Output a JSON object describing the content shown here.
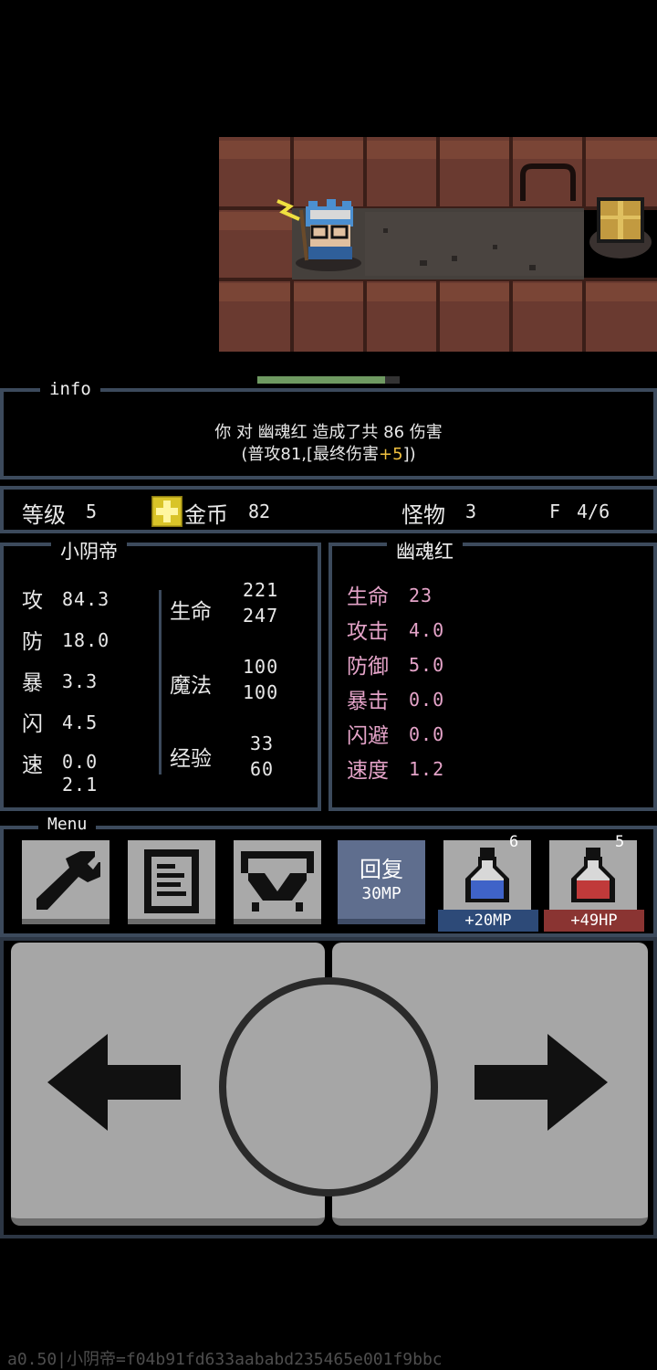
{
  "info": {
    "title": "info",
    "message_line1": "你 对 幽魂红 造成了共 86 伤害",
    "message_line2_prefix": "(普攻81,[最终伤害",
    "message_line2_bonus": "+5",
    "message_line2_suffix": "])"
  },
  "enemy_hp_fraction": 0.9,
  "status": {
    "level_label": "等级",
    "level_value": "5",
    "gold_label": "金币",
    "gold_value": "82",
    "monster_label": "怪物",
    "monster_value": "3",
    "floor_label": "F",
    "floor_value": "4/6"
  },
  "player": {
    "name": "小阴帝",
    "attack_label": "攻",
    "attack": "84.3",
    "defense_label": "防",
    "defense": "18.0",
    "crit_label": "暴",
    "crit": "3.3",
    "dodge_label": "闪",
    "dodge": "4.5",
    "speed_label": "速",
    "speed_a": "0.0",
    "speed_b": "2.1",
    "hp_label": "生命",
    "hp_current": "221",
    "hp_max": "247",
    "mp_label": "魔法",
    "mp_current": "100",
    "mp_max": "100",
    "exp_label": "经验",
    "exp_current": "33",
    "exp_max": "60"
  },
  "monster": {
    "name": "幽魂红",
    "hp_label": "生命",
    "hp": "23",
    "attack_label": "攻击",
    "attack": "4.0",
    "defense_label": "防御",
    "defense": "5.0",
    "crit_label": "暴击",
    "crit": "0.0",
    "dodge_label": "闪避",
    "dodge": "0.0",
    "speed_label": "速度",
    "speed": "1.2"
  },
  "menu": {
    "title": "Menu",
    "heal_label": "回复",
    "heal_cost": "30MP",
    "mp_potion_count": "6",
    "mp_potion_label": "+20MP",
    "hp_potion_count": "5",
    "hp_potion_label": "+49HP"
  },
  "colors": {
    "panel_border": "#3c4a5c",
    "monster_stat": "#e4a3c8",
    "heal_button": "#5f6e8e",
    "mp_label_bg": "#2d4a78",
    "hp_label_bg": "#8a3432"
  },
  "footer": "a0.50|小阴帝=f04b91fd633aababd235465e001f9bbc"
}
